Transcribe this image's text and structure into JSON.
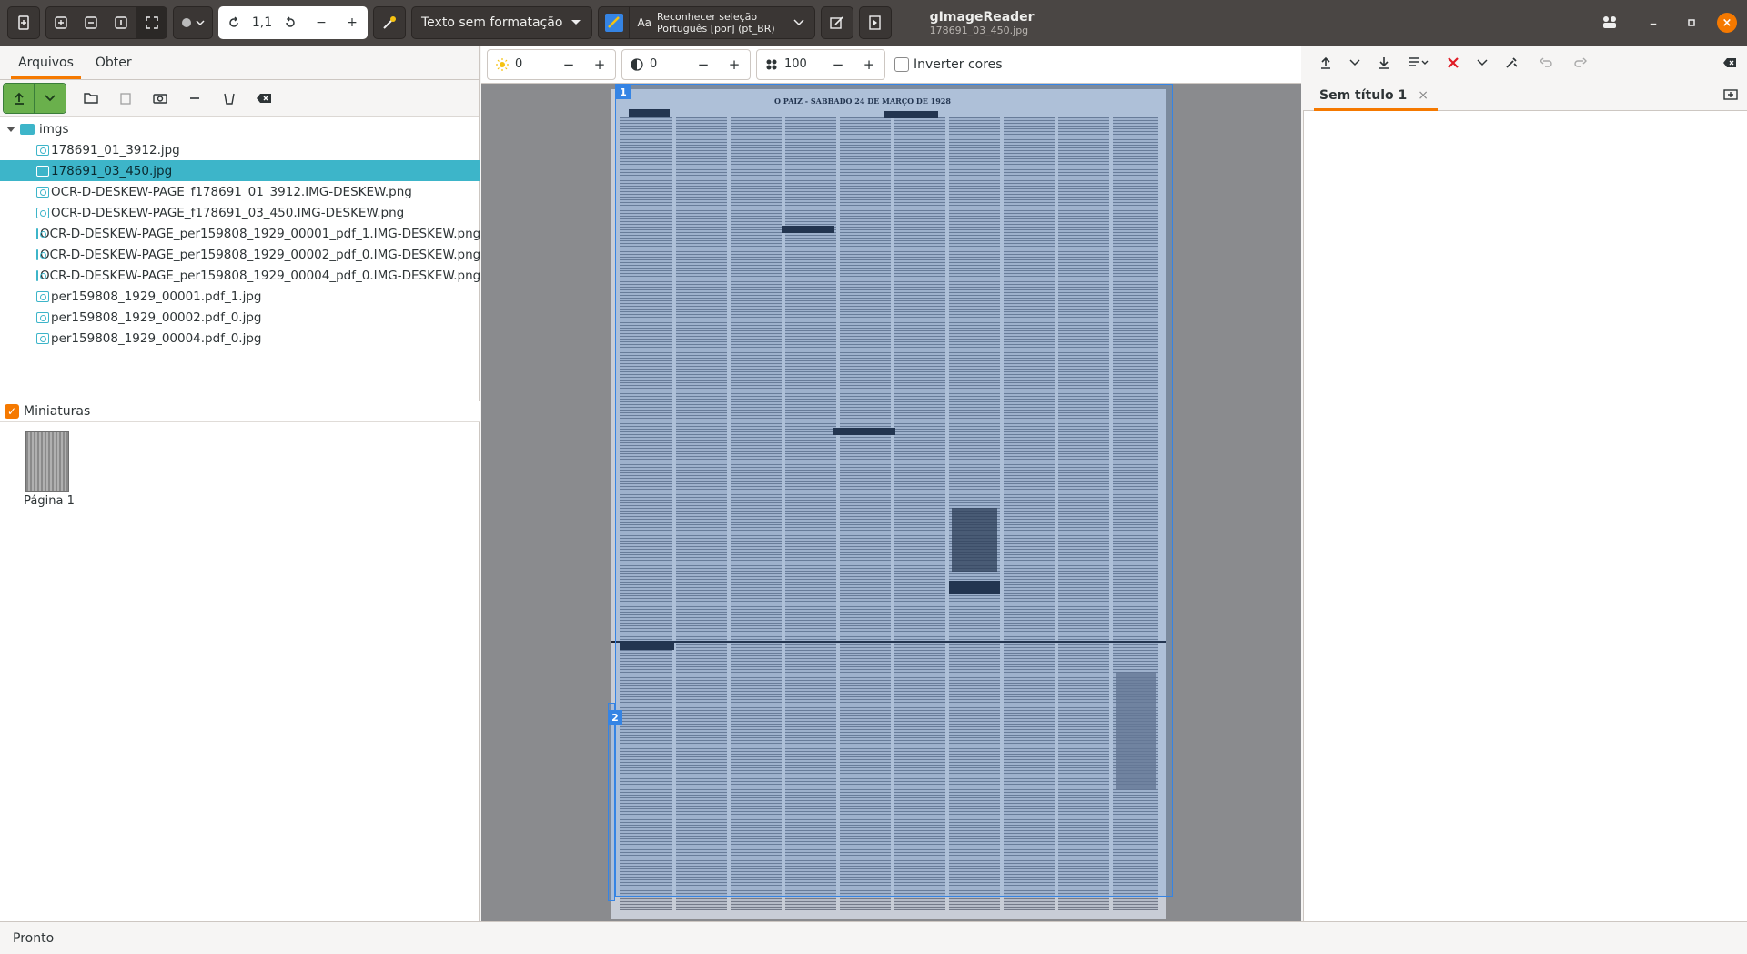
{
  "header": {
    "zoom_value": "1,1",
    "output_mode": "Texto sem formatação",
    "ocr_button_line1": "Reconhecer seleção",
    "ocr_button_line2": "Português [por] (pt_BR)",
    "app_title": "gImageReader",
    "subtitle": "178691_03_450.jpg"
  },
  "left_panel": {
    "tabs": [
      "Arquivos",
      "Obter"
    ],
    "folder": "imgs",
    "files": [
      "178691_01_3912.jpg",
      "178691_03_450.jpg",
      "OCR-D-DESKEW-PAGE_f178691_01_3912.IMG-DESKEW.png",
      "OCR-D-DESKEW-PAGE_f178691_03_450.IMG-DESKEW.png",
      "OCR-D-DESKEW-PAGE_per159808_1929_00001_pdf_1.IMG-DESKEW.png",
      "OCR-D-DESKEW-PAGE_per159808_1929_00002_pdf_0.IMG-DESKEW.png",
      "OCR-D-DESKEW-PAGE_per159808_1929_00004_pdf_0.IMG-DESKEW.png",
      "per159808_1929_00001.pdf_1.jpg",
      "per159808_1929_00002.pdf_0.jpg",
      "per159808_1929_00004.pdf_0.jpg"
    ],
    "selected_index": 1,
    "thumbnails_label": "Miniaturas",
    "thumbnail_caption": "Página 1"
  },
  "image_toolbar": {
    "brightness": "0",
    "contrast": "0",
    "resolution": "100",
    "invert_label": "Inverter cores"
  },
  "viewer": {
    "selection_1": "1",
    "selection_2": "2",
    "newspaper_header": "O PAIZ - SABBADO 24 DE MARÇO DE 1928"
  },
  "output_panel": {
    "tab_title": "Sem título 1"
  },
  "status": "Pronto",
  "colors": {
    "accent": "#f57900",
    "selection": "#3db5c9",
    "headerbar": "#4a4644"
  }
}
